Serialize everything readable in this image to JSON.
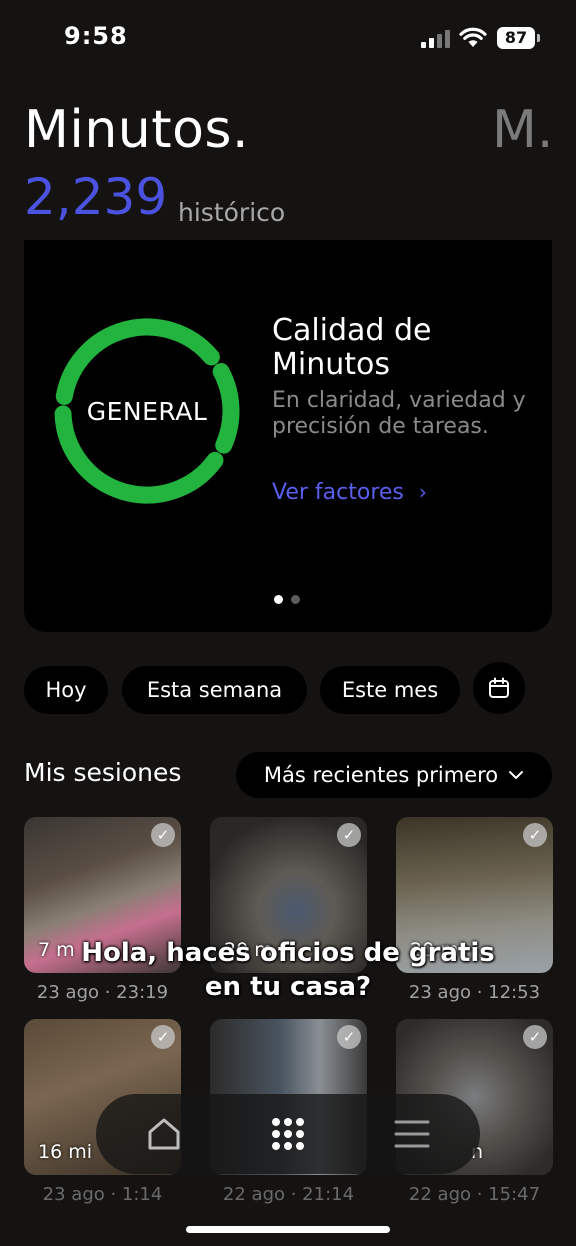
{
  "status_bar": {
    "time": "9:58",
    "battery": "87"
  },
  "header": {
    "title": "Minutos.",
    "avatar_initial": "M.",
    "minutes_value": "2,239",
    "minutes_caption": "histórico"
  },
  "quality_card": {
    "ring_label": "GENERAL",
    "title": "Calidad de Minutos",
    "description": "En claridad, variedad y precisión de tareas.",
    "link_label": "Ver factores",
    "link_chevron": "›",
    "ring_color": "#22b43f",
    "pages": 2,
    "active_page": 1
  },
  "filters": {
    "today": "Hoy",
    "week": "Esta semana",
    "month": "Este mes",
    "calendar_icon": "calendar-icon"
  },
  "sessions": {
    "title": "Mis sesiones",
    "sort_label": "Más recientes primero",
    "items": [
      {
        "duration": "7 m",
        "date": "23 ago · 23:19"
      },
      {
        "duration": "20 m",
        "date": ""
      },
      {
        "duration": "20 m",
        "date": "23 ago · 12:53"
      },
      {
        "duration": "16 mi",
        "date": "23 ago · 1:14"
      },
      {
        "duration": "",
        "date": "22 ago · 21:14"
      },
      {
        "duration": "n",
        "date": "22 ago · 15:47"
      }
    ]
  },
  "overlay_caption": "Hola, haces oficios de gratis en tu casa?",
  "nav": {
    "home": "home-icon",
    "grid": "grid-icon",
    "menu": "menu-icon"
  }
}
